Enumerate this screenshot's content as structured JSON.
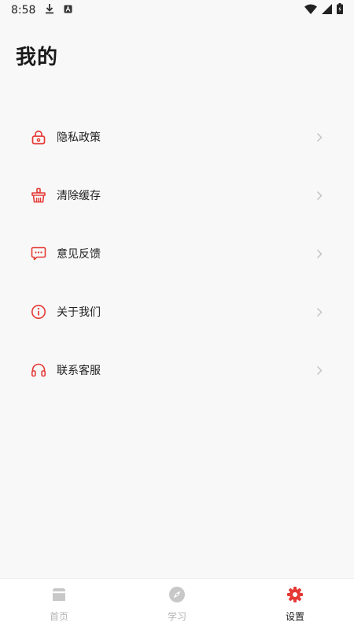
{
  "status_bar": {
    "time": "8:58",
    "icons": [
      "download-icon",
      "font-icon",
      "wifi-icon",
      "signal-icon",
      "battery-icon"
    ]
  },
  "page": {
    "title": "我的"
  },
  "menu": {
    "items": [
      {
        "label": "隐私政策",
        "icon": "lock-icon"
      },
      {
        "label": "清除缓存",
        "icon": "basket-icon"
      },
      {
        "label": "意见反馈",
        "icon": "chat-icon"
      },
      {
        "label": "关于我们",
        "icon": "info-icon"
      },
      {
        "label": "联系客服",
        "icon": "headset-icon"
      }
    ]
  },
  "tab_bar": {
    "tabs": [
      {
        "label": "首页",
        "icon": "home-icon",
        "active": false
      },
      {
        "label": "学习",
        "icon": "compass-icon",
        "active": false
      },
      {
        "label": "设置",
        "icon": "gear-icon",
        "active": true
      }
    ]
  },
  "colors": {
    "accent": "#e53935",
    "inactive": "#c8c8c8",
    "background": "#f8f8f8"
  }
}
